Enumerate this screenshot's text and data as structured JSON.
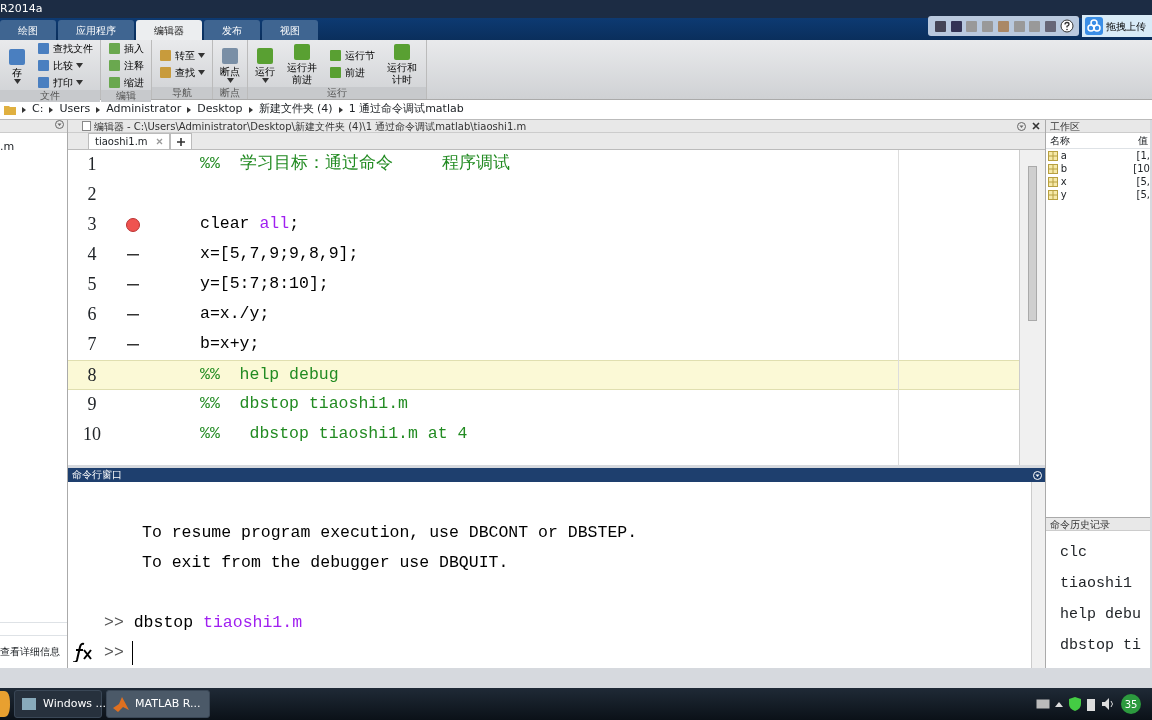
{
  "window": {
    "title": "R2014a"
  },
  "quick_access": {
    "upload_label": "拖拽上传"
  },
  "ribbon_tabs": [
    {
      "label": "绘图",
      "selected": false
    },
    {
      "label": "应用程序",
      "selected": false
    },
    {
      "label": "编辑器",
      "selected": true
    },
    {
      "label": "发布",
      "selected": false
    },
    {
      "label": "视图",
      "selected": false
    }
  ],
  "ribbon_groups": [
    {
      "label": "文件",
      "columns": [
        [
          {
            "label": "存",
            "kind": "large",
            "dropdown": true
          }
        ],
        [
          {
            "label": "查找文件",
            "kind": "small",
            "dropdown": false
          },
          {
            "label": "比较",
            "kind": "small",
            "dropdown": true
          },
          {
            "label": "打印",
            "kind": "small",
            "dropdown": true
          }
        ]
      ]
    },
    {
      "label": "编辑",
      "columns": [
        [
          {
            "label": "插入",
            "kind": "small",
            "dropdown": false
          },
          {
            "label": "注释",
            "kind": "small",
            "dropdown": false
          },
          {
            "label": "缩进",
            "kind": "small",
            "dropdown": false
          }
        ]
      ]
    },
    {
      "label": "导航",
      "columns": [
        [
          {
            "label": "转至",
            "kind": "small",
            "dropdown": true
          },
          {
            "label": "查找",
            "kind": "small",
            "dropdown": true
          }
        ]
      ]
    },
    {
      "label": "断点",
      "columns": [
        [
          {
            "label": "断点",
            "kind": "large",
            "dropdown": true
          }
        ]
      ]
    },
    {
      "label": "运行",
      "columns": [
        [
          {
            "label": "运行",
            "kind": "large",
            "dropdown": true
          }
        ],
        [
          {
            "label": "运行并前进",
            "kind": "large",
            "dropdown": false
          }
        ],
        [
          {
            "label": "运行节",
            "kind": "small",
            "dropdown": false
          },
          {
            "label": "前进",
            "kind": "small",
            "dropdown": false
          }
        ],
        [
          {
            "label": "运行和计时",
            "kind": "large",
            "dropdown": false
          }
        ]
      ]
    }
  ],
  "address_bar": {
    "path": [
      "C:",
      "Users",
      "Administrator",
      "Desktop",
      "新建文件夹 (4)",
      "1  通过命令调试matlab"
    ]
  },
  "file_browser": {
    "items": [
      ".m"
    ],
    "details_label": "查看详细信息"
  },
  "editor": {
    "title": "编辑器 - C:\\Users\\Administrator\\Desktop\\新建文件夹 (4)\\1  通过命令调试matlab\\tiaoshi1.m",
    "tabs": [
      {
        "label": "tiaoshi1.m",
        "selected": true
      }
    ],
    "lines": [
      {
        "number": "1",
        "breakpoint": false,
        "executable": false,
        "highlighted": false,
        "segments": [
          {
            "text": "%%  学习目标：通过命令     程序调试",
            "kind": "comment"
          }
        ]
      },
      {
        "number": "2",
        "breakpoint": false,
        "executable": false,
        "highlighted": false
      },
      {
        "number": "3",
        "breakpoint": true,
        "executable": false,
        "highlighted": false,
        "segments": [
          {
            "text": "clear ",
            "kind": "code"
          },
          {
            "text": "all",
            "kind": "string"
          },
          {
            "text": ";",
            "kind": "code"
          }
        ]
      },
      {
        "number": "4",
        "breakpoint": false,
        "executable": true,
        "highlighted": false,
        "segments": [
          {
            "text": "x=[5,7,9;9,8,9];",
            "kind": "code"
          }
        ]
      },
      {
        "number": "5",
        "breakpoint": false,
        "executable": true,
        "highlighted": false,
        "segments": [
          {
            "text": "y=[5:7;8:10];",
            "kind": "code"
          }
        ]
      },
      {
        "number": "6",
        "breakpoint": false,
        "executable": true,
        "highlighted": false,
        "segments": [
          {
            "text": "a=x./y;",
            "kind": "code"
          }
        ]
      },
      {
        "number": "7",
        "breakpoint": false,
        "executable": true,
        "highlighted": false,
        "segments": [
          {
            "text": "b=x+y;",
            "kind": "code"
          }
        ]
      },
      {
        "number": "8",
        "breakpoint": false,
        "executable": false,
        "highlighted": true,
        "segments": [
          {
            "text": "%%  help debug",
            "kind": "comment"
          }
        ]
      },
      {
        "number": "9",
        "breakpoint": false,
        "executable": false,
        "highlighted": false,
        "segments": [
          {
            "text": "%%  dbstop tiaoshi1.m",
            "kind": "comment"
          }
        ]
      },
      {
        "number": "10",
        "breakpoint": false,
        "executable": false,
        "highlighted": false,
        "segments": [
          {
            "text": "%%   dbstop tiaoshi1.m at 4",
            "kind": "comment"
          }
        ]
      }
    ]
  },
  "command_window": {
    "title": "命令行窗口",
    "lines": [
      {
        "kind": "blank"
      },
      {
        "kind": "output",
        "segments": [
          {
            "text": "To resume program execution, use DBCONT or DBSTEP.",
            "kind": "code"
          }
        ]
      },
      {
        "kind": "output",
        "segments": [
          {
            "text": "To exit from the debugger use DBQUIT.",
            "kind": "code"
          }
        ]
      },
      {
        "kind": "blank"
      },
      {
        "kind": "command",
        "prompt": ">>",
        "segments": [
          {
            "text": "dbstop ",
            "kind": "code"
          },
          {
            "text": "tiaoshi1.m",
            "kind": "string"
          }
        ]
      }
    ],
    "prompt": ">>"
  },
  "workspace": {
    "title": "工作区",
    "columns": [
      "名称",
      "值"
    ],
    "rows": [
      {
        "name": "a",
        "value": "[1,"
      },
      {
        "name": "b",
        "value": "[10"
      },
      {
        "name": "x",
        "value": "[5,"
      },
      {
        "name": "y",
        "value": "[5,"
      }
    ]
  },
  "command_history": {
    "title": "命令历史记录",
    "items": [
      "clc",
      "tiaoshi1",
      "help debu",
      "dbstop ti"
    ]
  },
  "taskbar": {
    "buttons": [
      {
        "label": "Windows ...",
        "selected": false
      },
      {
        "label": "MATLAB R...",
        "selected": true
      }
    ],
    "tray_badge": "35"
  }
}
